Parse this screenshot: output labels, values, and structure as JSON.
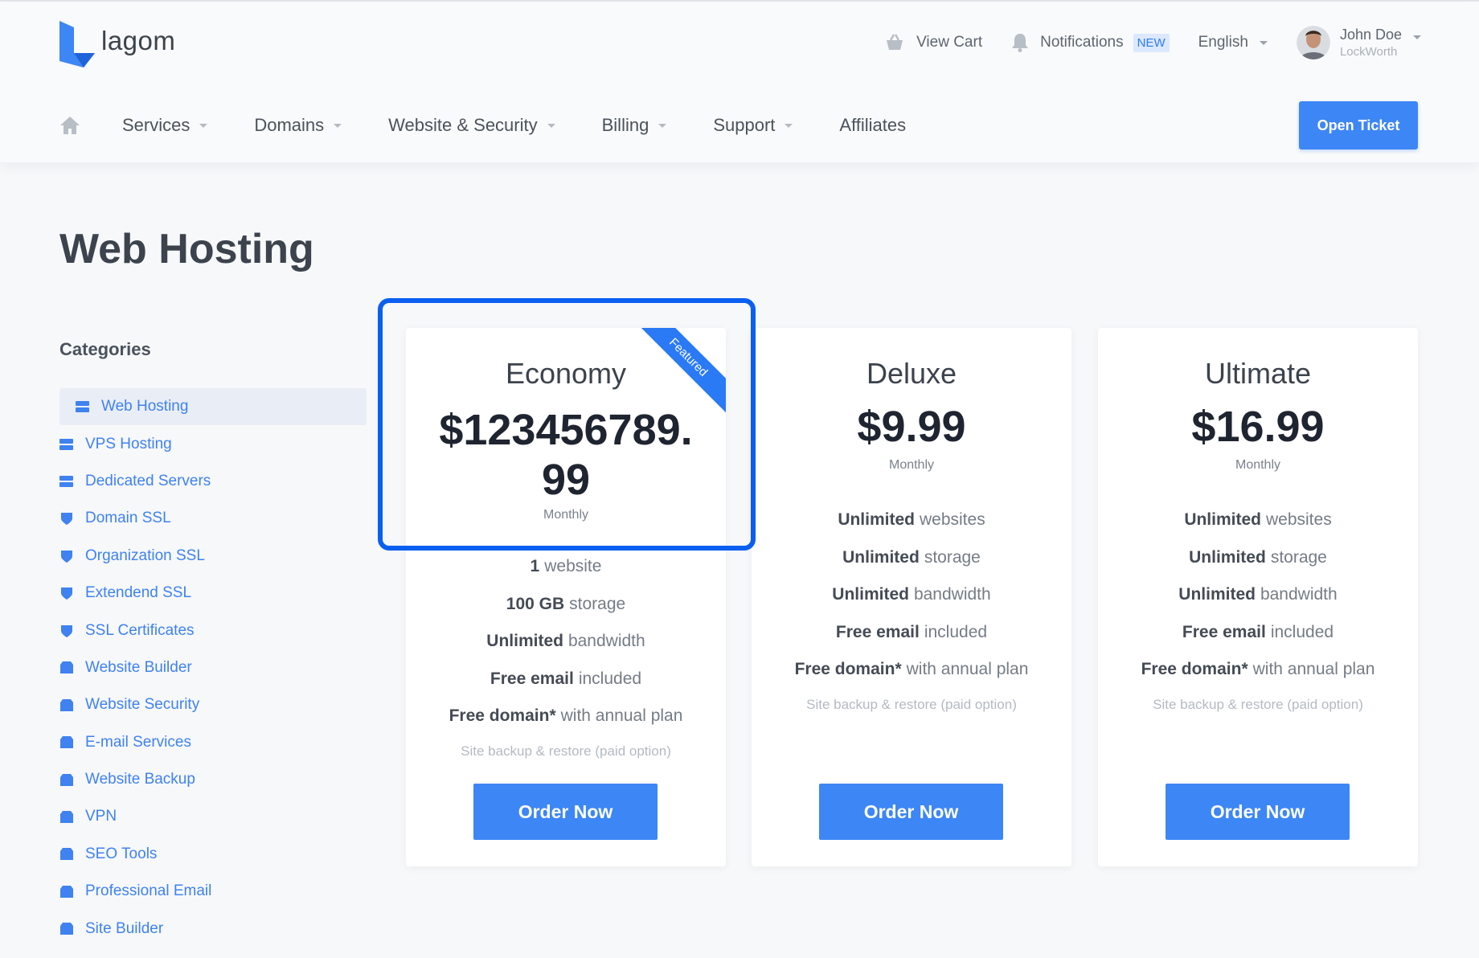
{
  "brand": {
    "name": "lagom",
    "color": "#3d86f5"
  },
  "top_tools": {
    "cart": {
      "label": "View Cart",
      "icon": "basket-icon"
    },
    "notifications": {
      "label": "Notifications",
      "badge": "NEW",
      "icon": "bell-icon"
    },
    "language": {
      "label": "English"
    },
    "user": {
      "name": "John Doe",
      "company": "LockWorth"
    }
  },
  "nav": {
    "items": [
      {
        "label": "Services"
      },
      {
        "label": "Domains"
      },
      {
        "label": "Website & Security"
      },
      {
        "label": "Billing"
      },
      {
        "label": "Support"
      },
      {
        "label": "Affiliates"
      }
    ],
    "open_ticket": "Open Ticket"
  },
  "page": {
    "title": "Web Hosting"
  },
  "sidebar": {
    "title": "Categories",
    "items": [
      {
        "label": "Web Hosting",
        "icon": "server-icon",
        "active": true
      },
      {
        "label": "VPS Hosting",
        "icon": "server-icon"
      },
      {
        "label": "Dedicated Servers",
        "icon": "server-icon"
      },
      {
        "label": "Domain SSL",
        "icon": "shield-icon"
      },
      {
        "label": "Organization SSL",
        "icon": "shield-icon"
      },
      {
        "label": "Extendend SSL",
        "icon": "shield-icon"
      },
      {
        "label": "SSL Certificates",
        "icon": "shield-icon"
      },
      {
        "label": "Website Builder",
        "icon": "box-icon"
      },
      {
        "label": "Website Security",
        "icon": "box-icon"
      },
      {
        "label": "E-mail Services",
        "icon": "box-icon"
      },
      {
        "label": "Website Backup",
        "icon": "box-icon"
      },
      {
        "label": "VPN",
        "icon": "box-icon"
      },
      {
        "label": "SEO Tools",
        "icon": "box-icon"
      },
      {
        "label": "Professional Email",
        "icon": "box-icon"
      },
      {
        "label": "Site Builder",
        "icon": "box-icon"
      }
    ]
  },
  "plans": [
    {
      "name": "Economy",
      "price_line1": "$123456789.",
      "price_line2": "99",
      "cycle": "Monthly",
      "ribbon": "Featured",
      "features": [
        {
          "bold": "1",
          "text": "website"
        },
        {
          "bold": "100 GB",
          "text": "storage"
        },
        {
          "bold": "Unlimited",
          "text": "bandwidth"
        },
        {
          "bold": "Free email",
          "text": "included"
        },
        {
          "bold": "Free domain*",
          "text": "with annual plan"
        }
      ],
      "note": "Site backup & restore (paid option)",
      "button": "Order Now"
    },
    {
      "name": "Deluxe",
      "price": "$9.99",
      "cycle": "Monthly",
      "features": [
        {
          "bold": "Unlimited",
          "text": "websites"
        },
        {
          "bold": "Unlimited",
          "text": "storage"
        },
        {
          "bold": "Unlimited",
          "text": "bandwidth"
        },
        {
          "bold": "Free email",
          "text": "included"
        },
        {
          "bold": "Free domain*",
          "text": "with annual plan"
        }
      ],
      "note": "Site backup & restore (paid option)",
      "button": "Order Now"
    },
    {
      "name": "Ultimate",
      "price": "$16.99",
      "cycle": "Monthly",
      "features": [
        {
          "bold": "Unlimited",
          "text": "websites"
        },
        {
          "bold": "Unlimited",
          "text": "storage"
        },
        {
          "bold": "Unlimited",
          "text": "bandwidth"
        },
        {
          "bold": "Free email",
          "text": "included"
        },
        {
          "bold": "Free domain*",
          "text": "with annual plan"
        }
      ],
      "note": "Site backup & restore (paid option)",
      "button": "Order Now"
    }
  ],
  "colors": {
    "accent": "#3d86f5",
    "link": "#3f82f0",
    "highlight": "#0b5ff0"
  }
}
